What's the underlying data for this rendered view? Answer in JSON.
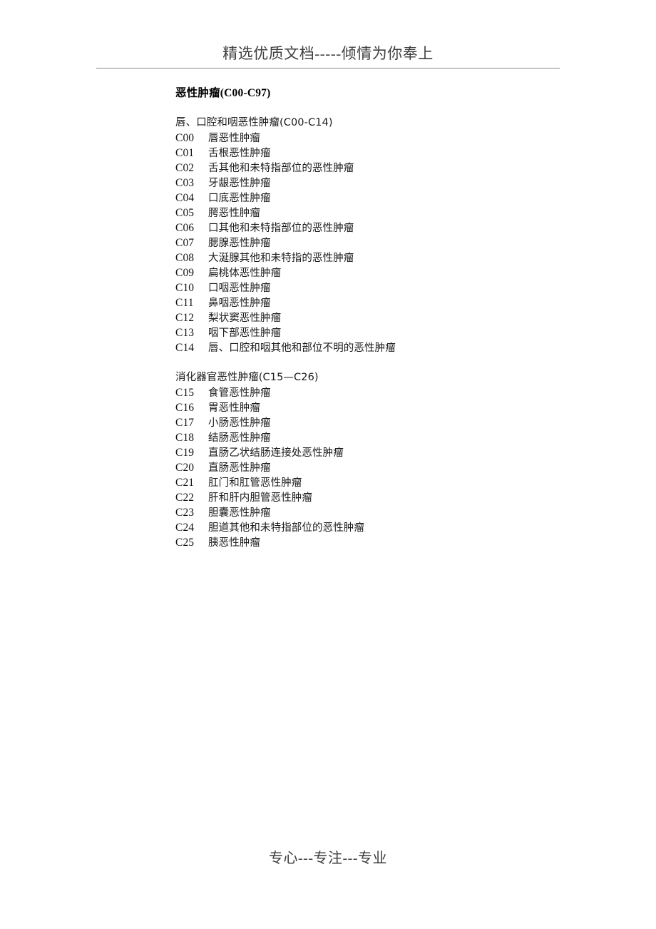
{
  "header": {
    "text": "精选优质文档-----倾情为你奉上"
  },
  "footer": {
    "text": "专心---专注---专业"
  },
  "document": {
    "title": "恶性肿瘤(C00-C97)",
    "sections": [
      {
        "heading": "唇、口腔和咽恶性肿瘤(C00-C14)",
        "rows": [
          {
            "code": "C00",
            "name": "唇恶性肿瘤"
          },
          {
            "code": "C01",
            "name": "舌根恶性肿瘤"
          },
          {
            "code": "C02",
            "name": "舌其他和未特指部位的恶性肿瘤"
          },
          {
            "code": "C03",
            "name": "牙龈恶性肿瘤"
          },
          {
            "code": "C04",
            "name": "口底恶性肿瘤"
          },
          {
            "code": "C05",
            "name": "腭恶性肿瘤"
          },
          {
            "code": "C06",
            "name": "口其他和未特指部位的恶性肿瘤"
          },
          {
            "code": "C07",
            "name": "腮腺恶性肿瘤"
          },
          {
            "code": "C08",
            "name": "大涎腺其他和未特指的恶性肿瘤"
          },
          {
            "code": "C09",
            "name": "扁桃体恶性肿瘤"
          },
          {
            "code": "C10",
            "name": "口咽恶性肿瘤"
          },
          {
            "code": "C11",
            "name": "鼻咽恶性肿瘤"
          },
          {
            "code": "C12",
            "name": "梨状窦恶性肿瘤"
          },
          {
            "code": "C13",
            "name": "咽下部恶性肿瘤"
          },
          {
            "code": "C14",
            "name": "唇、口腔和咽其他和部位不明的恶性肿瘤"
          }
        ]
      },
      {
        "heading": "消化器官恶性肿瘤(C15—C26)",
        "rows": [
          {
            "code": "C15",
            "name": "食管恶性肿瘤"
          },
          {
            "code": "C16",
            "name": "胃恶性肿瘤"
          },
          {
            "code": "C17",
            "name": "小肠恶性肿瘤"
          },
          {
            "code": "C18",
            "name": "结肠恶性肿瘤"
          },
          {
            "code": "C19",
            "name": "直肠乙状结肠连接处恶性肿瘤"
          },
          {
            "code": "C20",
            "name": "直肠恶性肿瘤"
          },
          {
            "code": "C21",
            "name": "肛门和肛管恶性肿瘤"
          },
          {
            "code": "C22",
            "name": "肝和肝内胆管恶性肿瘤"
          },
          {
            "code": "C23",
            "name": "胆囊恶性肿瘤"
          },
          {
            "code": "C24",
            "name": "胆道其他和未特指部位的恶性肿瘤"
          },
          {
            "code": "C25",
            "name": "胰恶性肿瘤"
          }
        ]
      }
    ]
  }
}
